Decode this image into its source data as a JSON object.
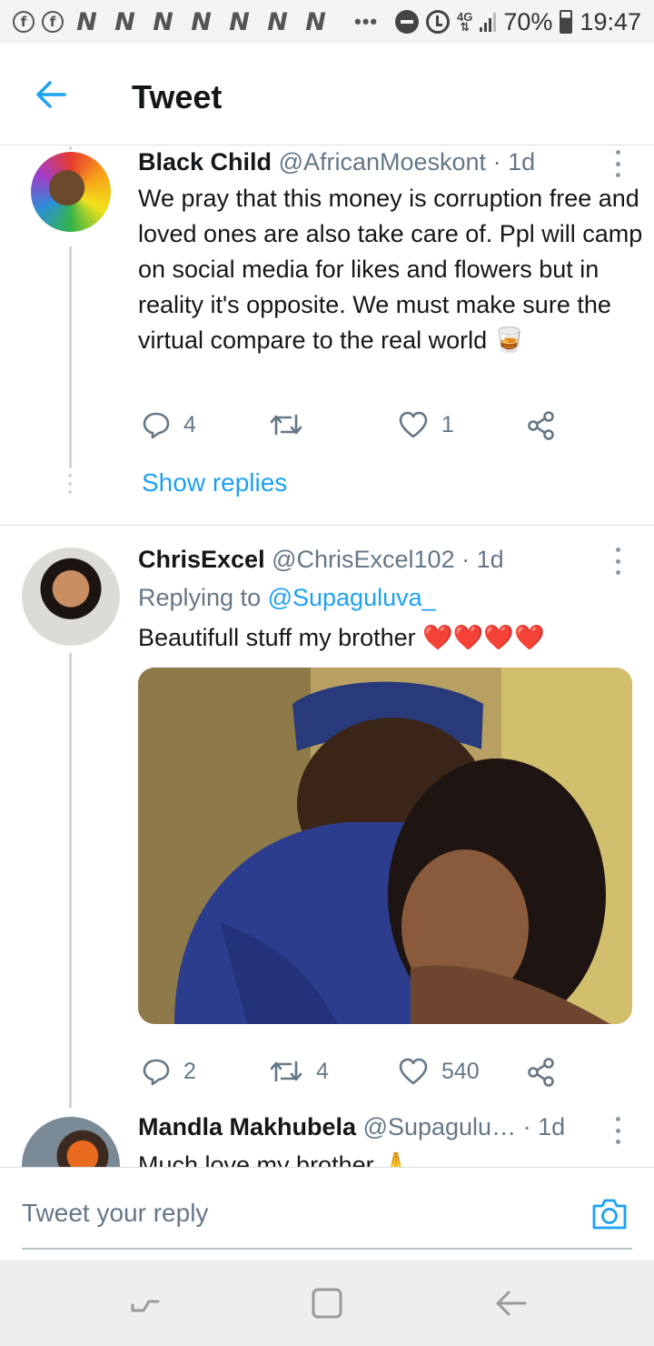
{
  "status_bar": {
    "left_icons": [
      "facebook-icon",
      "facebook-icon",
      "n-icon",
      "n-icon",
      "n-icon",
      "n-icon",
      "n-icon",
      "n-icon",
      "n-icon"
    ],
    "fb_glyph": "f",
    "n_glyph": "N",
    "more_glyph": "•••",
    "net_label_top": "4G",
    "net_label_bottom": "⇅",
    "battery": "70%",
    "time": "19:47"
  },
  "app_bar": {
    "title": "Tweet"
  },
  "tweets": [
    {
      "name": "Black Child",
      "handle": "@AfricanMoeskont",
      "time": "· 1d",
      "text": "We pray that this money is corruption free and loved ones are also take care of. Ppl will camp on social media for likes and flowers but in reality it's opposite. We must make sure the virtual compare to the real world 🥃",
      "replies": "4",
      "retweets": "",
      "likes": "1",
      "show_replies": "Show replies"
    },
    {
      "name": "ChrisExcel",
      "handle": "@ChrisExcel102",
      "time": "· 1d",
      "replying_prefix": "Replying to ",
      "replying_handle": "@Supaguluva_",
      "text": "Beautifull stuff my brother ❤️❤️❤️❤️",
      "replies": "2",
      "retweets": "4",
      "likes": "540"
    },
    {
      "name": "Mandla Makhubela",
      "handle": "@Supagulu…",
      "time": "· 1d",
      "text": "Much love my brother 🙏"
    }
  ],
  "reply_bar": {
    "placeholder": "Tweet your reply"
  },
  "colors": {
    "accent": "#1da1f2",
    "text": "#14171a",
    "secondary": "#657786",
    "divider": "#d9dee2"
  }
}
